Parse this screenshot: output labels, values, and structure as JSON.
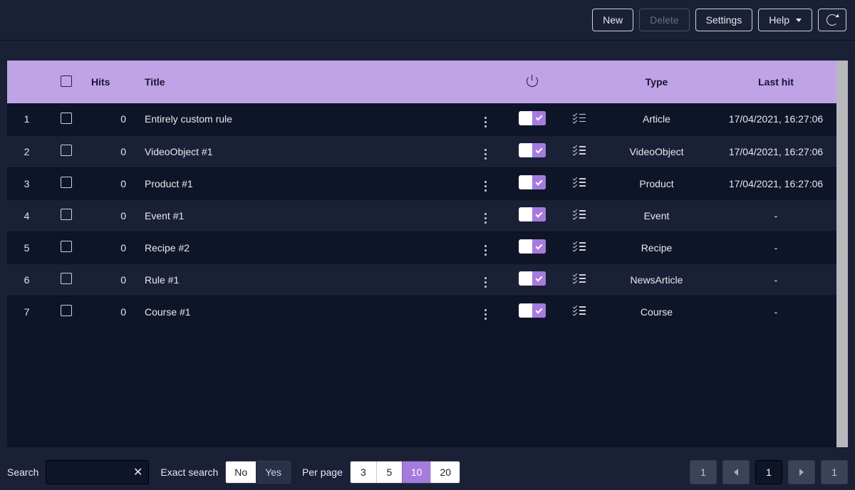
{
  "toolbar": {
    "new": "New",
    "delete": "Delete",
    "settings": "Settings",
    "help": "Help"
  },
  "columns": {
    "hits": "Hits",
    "title": "Title",
    "type": "Type",
    "lasthit": "Last hit"
  },
  "rows": [
    {
      "n": "1",
      "hits": "0",
      "title": "Entirely custom rule",
      "type": "Article",
      "lasthit": "17/04/2021, 16:27:06"
    },
    {
      "n": "2",
      "hits": "0",
      "title": "VideoObject #1",
      "type": "VideoObject",
      "lasthit": "17/04/2021, 16:27:06"
    },
    {
      "n": "3",
      "hits": "0",
      "title": "Product #1",
      "type": "Product",
      "lasthit": "17/04/2021, 16:27:06"
    },
    {
      "n": "4",
      "hits": "0",
      "title": "Event #1",
      "type": "Event",
      "lasthit": "-"
    },
    {
      "n": "5",
      "hits": "0",
      "title": "Recipe #2",
      "type": "Recipe",
      "lasthit": "-"
    },
    {
      "n": "6",
      "hits": "0",
      "title": "Rule #1",
      "type": "NewsArticle",
      "lasthit": "-"
    },
    {
      "n": "7",
      "hits": "0",
      "title": "Course #1",
      "type": "Course",
      "lasthit": "-"
    }
  ],
  "footer": {
    "search_label": "Search",
    "search_value": "",
    "exact_label": "Exact search",
    "exact_no": "No",
    "exact_yes": "Yes",
    "perpage_label": "Per page",
    "perpage_options": [
      "3",
      "5",
      "10",
      "20"
    ],
    "perpage_selected": "10",
    "pager_first": "1",
    "pager_current": "1",
    "pager_last": "1"
  }
}
